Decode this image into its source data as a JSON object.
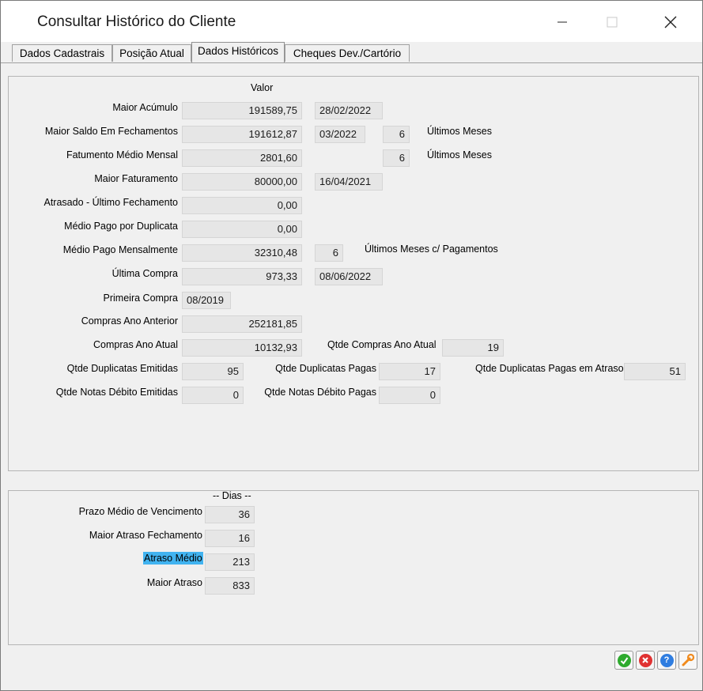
{
  "window": {
    "title": "Consultar Histórico do Cliente"
  },
  "tabs": [
    "Dados Cadastrais",
    "Posição Atual",
    "Dados Históricos",
    "Cheques Dev./Cartório"
  ],
  "history": {
    "valor_header": "Valor",
    "maior_acumulo": {
      "label": "Maior Acúmulo",
      "value": "191589,75",
      "date": "28/02/2022"
    },
    "maior_saldo": {
      "label": "Maior Saldo Em Fechamentos",
      "value": "191612,87",
      "month": "03/2022",
      "months": "6",
      "months_label": "Últimos Meses"
    },
    "faturamento_medio": {
      "label": "Fatumento Médio Mensal",
      "value": "2801,60",
      "months": "6",
      "months_label": "Últimos Meses"
    },
    "maior_faturamento": {
      "label": "Maior Faturamento",
      "value": "80000,00",
      "date": "16/04/2021"
    },
    "atrasado": {
      "label": "Atrasado - Último Fechamento",
      "value": "0,00"
    },
    "medio_pago_duplicata": {
      "label": "Médio Pago por Duplicata",
      "value": "0,00"
    },
    "medio_pago_mensal": {
      "label": "Médio Pago Mensalmente",
      "value": "32310,48",
      "months": "6",
      "months_label": "Últimos Meses c/ Pagamentos"
    },
    "ultima_compra": {
      "label": "Última Compra",
      "value": "973,33",
      "date": "08/06/2022"
    },
    "primeira_compra": {
      "label": "Primeira Compra",
      "value": "08/2019"
    },
    "compras_ano_anterior": {
      "label": "Compras Ano Anterior",
      "value": "252181,85"
    },
    "compras_ano_atual": {
      "label": "Compras Ano Atual",
      "value": "10132,93",
      "qtde_label": "Qtde Compras Ano Atual",
      "qtde": "19"
    },
    "duplicatas": {
      "emitidas_label": "Qtde Duplicatas Emitidas",
      "emitidas": "95",
      "pagas_label": "Qtde Duplicatas Pagas",
      "pagas": "17",
      "atraso_label": "Qtde Duplicatas Pagas em Atraso",
      "atraso": "51"
    },
    "notas_debito": {
      "emitidas_label": "Qtde Notas Débito Emitidas",
      "emitidas": "0",
      "pagas_label": "Qtde Notas Débito Pagas",
      "pagas": "0"
    }
  },
  "dias": {
    "header": "-- Dias --",
    "prazo_medio": {
      "label": "Prazo Médio de Vencimento",
      "value": "36"
    },
    "maior_atraso_fech": {
      "label": "Maior Atraso Fechamento",
      "value": "16"
    },
    "atraso_medio": {
      "label": "Atraso Médio",
      "value": "213"
    },
    "maior_atraso": {
      "label": "Maior Atraso",
      "value": "833"
    }
  },
  "colors": {
    "highlight": "#41b3f0",
    "ok": "#2eaa2e",
    "cancel": "#e03232",
    "help": "#2f7de0",
    "tool": "#f08a1c"
  },
  "icons": [
    "minimize-icon",
    "maximize-icon",
    "close-icon",
    "check-icon",
    "cancel-icon",
    "help-icon",
    "wrench-icon"
  ]
}
